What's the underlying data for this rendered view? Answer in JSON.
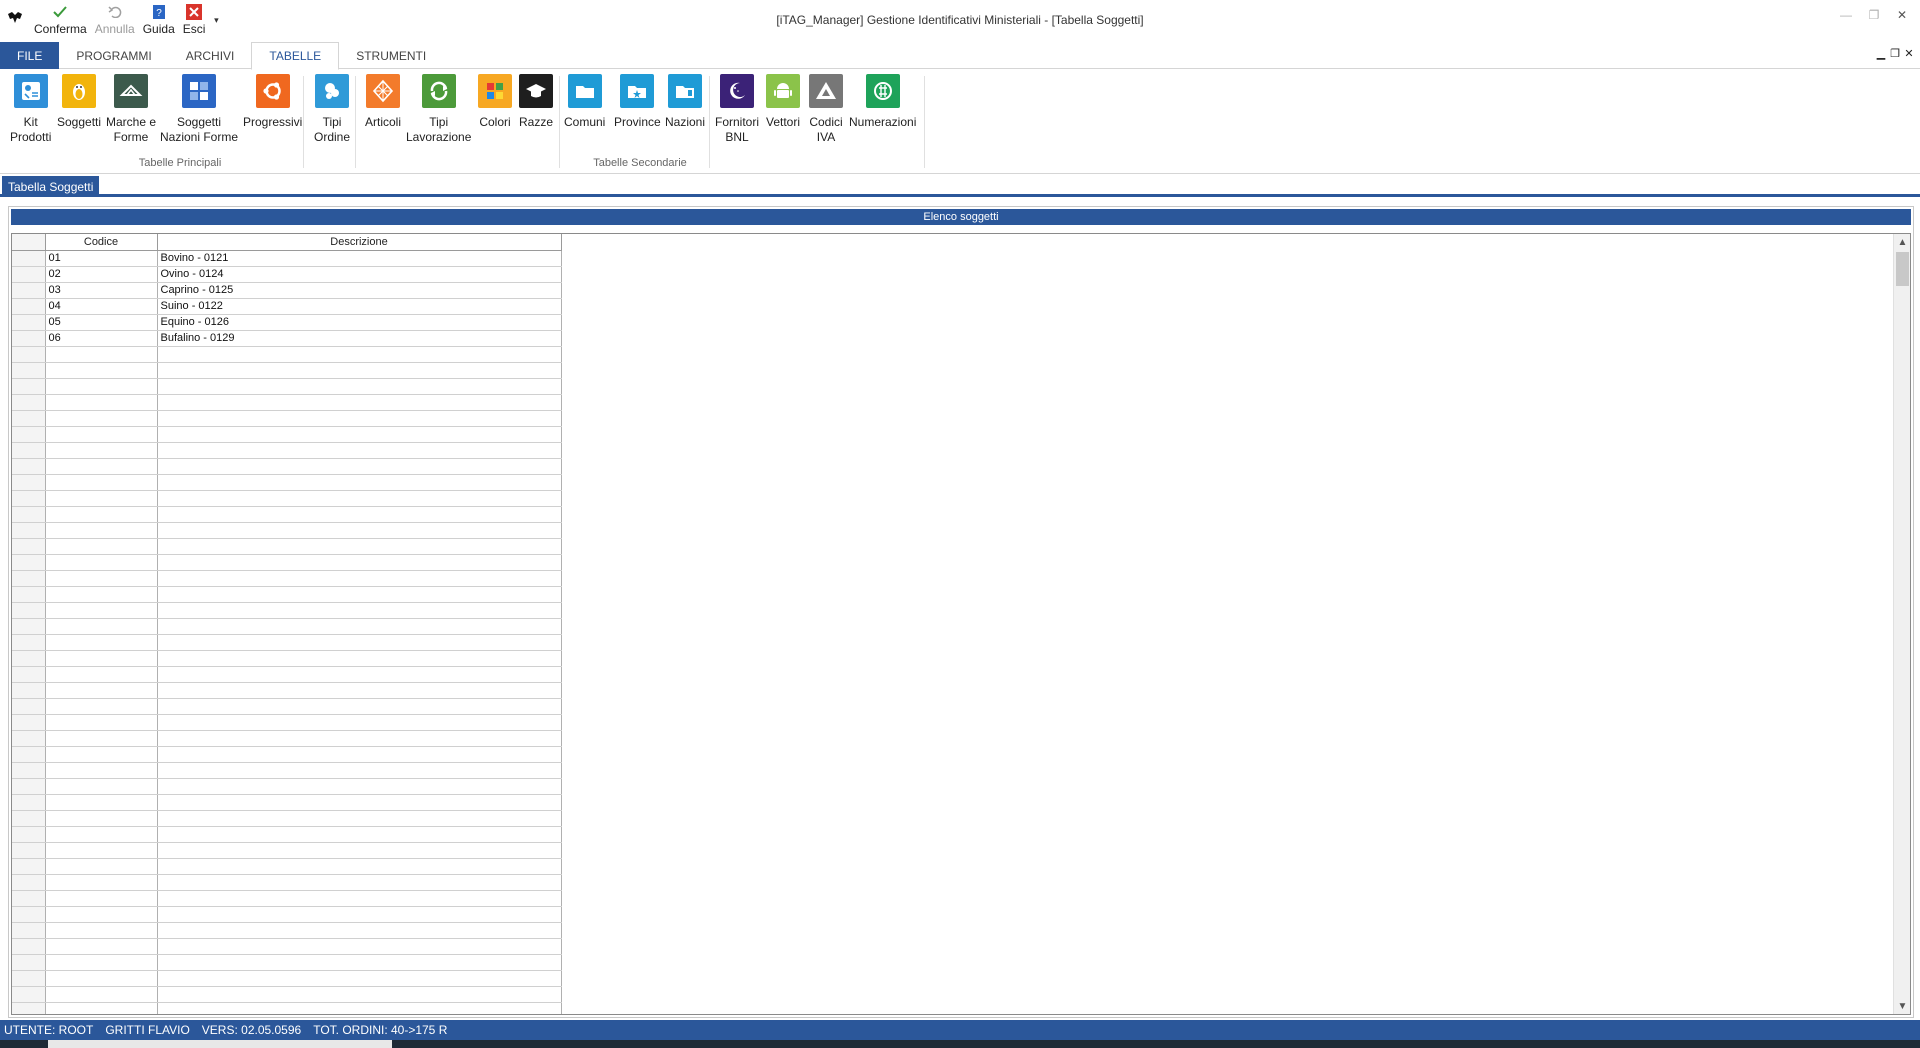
{
  "window": {
    "title": "[iTAG_Manager] Gestione Identificativi Ministeriali - [Tabella Soggetti]"
  },
  "quick_access": [
    {
      "label": "Conferma",
      "icon": "check-icon",
      "enabled": true
    },
    {
      "label": "Annulla",
      "icon": "undo-icon",
      "enabled": false
    },
    {
      "label": "Guida",
      "icon": "help-book-icon",
      "enabled": true
    },
    {
      "label": "Esci",
      "icon": "exit-x-icon",
      "enabled": true
    }
  ],
  "ribbon_tabs": [
    "FILE",
    "PROGRAMMI",
    "ARCHIVI",
    "TABELLE",
    "STRUMENTI"
  ],
  "active_tab": "TABELLE",
  "ribbon": {
    "groups": [
      {
        "label": "Tabelle Principali",
        "buttons": [
          {
            "label": "Kit\nProdotti",
            "icon": "kit-icon",
            "color": "#2f8fd8"
          },
          {
            "label": "Soggetti",
            "icon": "penguin-icon",
            "color": "#f2b40c"
          },
          {
            "label": "Marche e\nForme",
            "icon": "tag-shape-icon",
            "color": "#3c5a4c"
          },
          {
            "label": "Soggetti\nNazioni Forme",
            "icon": "grid-squares-icon",
            "color": "#2b66c4"
          },
          {
            "label": "Progressivi",
            "icon": "ubuntu-icon",
            "color": "#f0681f"
          },
          {
            "label": "Tipi\nOrdine",
            "icon": "cloud-person-icon",
            "color": "#2f9ad8"
          }
        ]
      },
      {
        "label": "Tabelle Secondarie",
        "buttons": [
          {
            "label": "Articoli",
            "icon": "diamond-icon",
            "color": "#f37b2b"
          },
          {
            "label": "Tipi\nLavorazione",
            "icon": "recycle-icon",
            "color": "#4c9a3a"
          },
          {
            "label": "Colori",
            "icon": "palette-icon",
            "color": "#f7a823"
          },
          {
            "label": "Razze",
            "icon": "graduation-cap-icon",
            "color": "#1e1e1e"
          },
          {
            "label": "Comuni",
            "icon": "folder-icon",
            "color": "#1f9bd6"
          },
          {
            "label": "Province",
            "icon": "star-folder-icon",
            "color": "#1f9bd6"
          },
          {
            "label": "Nazioni",
            "icon": "doc-folder-icon",
            "color": "#1f9bd6"
          }
        ]
      },
      {
        "label": "",
        "buttons": [
          {
            "label": "Fornitori\nBNL",
            "icon": "moon-icon",
            "color": "#3b2277"
          },
          {
            "label": "Vettori",
            "icon": "android-icon",
            "color": "#8bc34a"
          },
          {
            "label": "Codici\nIVA",
            "icon": "triangle-icon",
            "color": "#777777"
          },
          {
            "label": "Numerazioni",
            "icon": "globe-icon",
            "color": "#1ea35a"
          }
        ]
      }
    ]
  },
  "document_tab": "Tabella Soggetti",
  "panel": {
    "header": "Elenco soggetti",
    "columns": [
      "Codice",
      "Descrizione"
    ],
    "rows": [
      {
        "code": "01",
        "desc": "Bovino - 0121"
      },
      {
        "code": "02",
        "desc": "Ovino - 0124"
      },
      {
        "code": "03",
        "desc": "Caprino - 0125"
      },
      {
        "code": "04",
        "desc": "Suino - 0122"
      },
      {
        "code": "05",
        "desc": "Equino - 0126"
      },
      {
        "code": "06",
        "desc": "Bufalino - 0129"
      }
    ]
  },
  "status_bar": {
    "user": "UTENTE: ROOT",
    "name": "GRITTI FLAVIO",
    "version": "VERS: 02.05.0596",
    "orders": "TOT. ORDINI: 40->175 R"
  },
  "colors": {
    "accent": "#2b579a",
    "exit_red": "#d9342b",
    "confirm_green": "#3a9a3a"
  }
}
